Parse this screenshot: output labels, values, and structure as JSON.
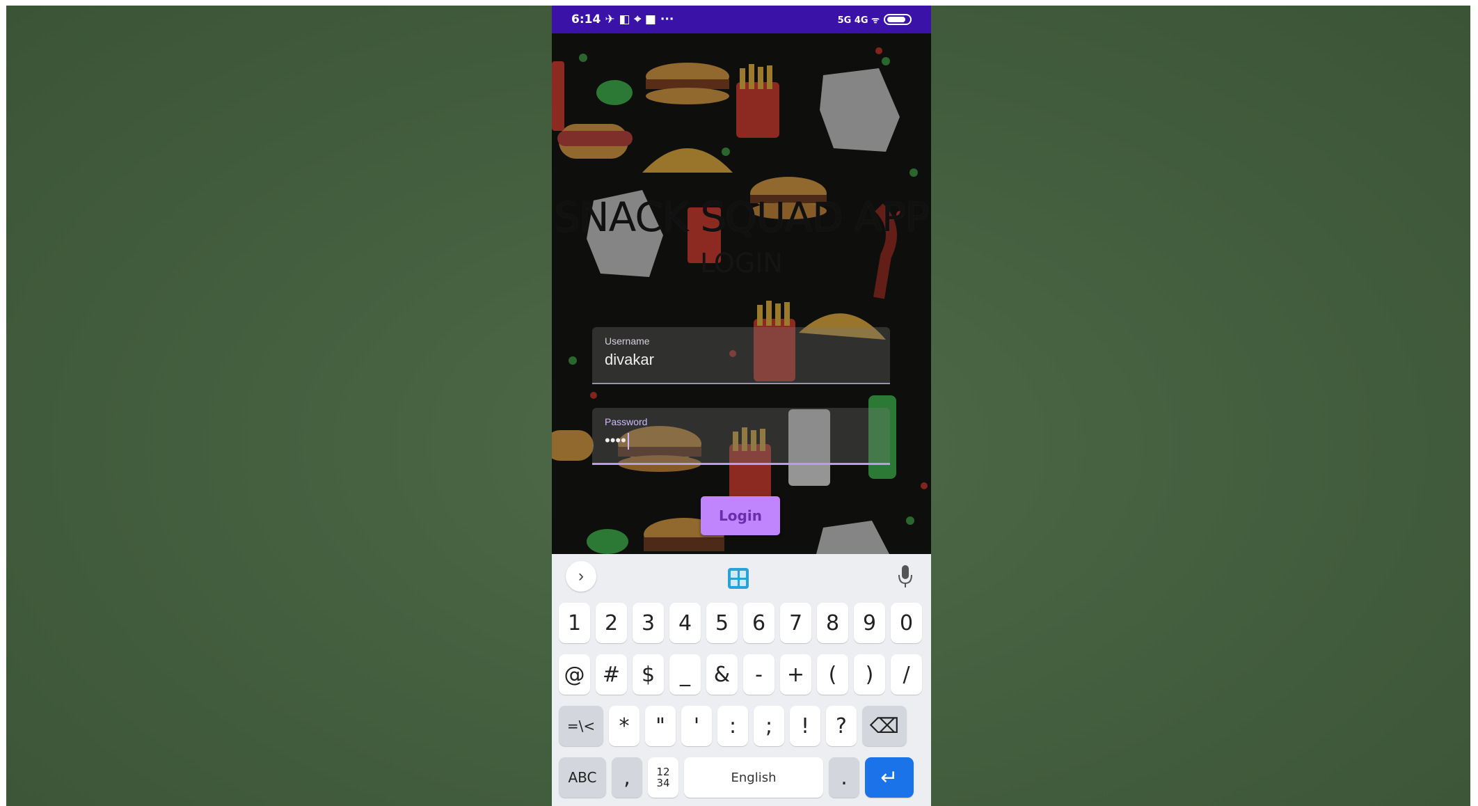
{
  "status_bar": {
    "time": "6:14",
    "left_icons": "✈ ◧ ⌖ ■ ···",
    "right_text": "5G 4G ᯤ",
    "battery": "80"
  },
  "app": {
    "title": "SNACK SQUAD APP",
    "heading": "LOGIN",
    "username": {
      "label": "Username",
      "value": "divakar"
    },
    "password": {
      "label": "Password",
      "value": "••••"
    },
    "login_button": "Login"
  },
  "keyboard": {
    "chevron": "›",
    "row1": [
      "1",
      "2",
      "3",
      "4",
      "5",
      "6",
      "7",
      "8",
      "9",
      "0"
    ],
    "row2": [
      "@",
      "#",
      "$",
      "_",
      "&",
      "-",
      "+",
      "(",
      ")",
      "/"
    ],
    "row3": [
      "*",
      "\"",
      "'",
      ":",
      ";",
      "!",
      "?"
    ],
    "row3_left": "=\\<",
    "row3_right": "⌫",
    "row4_abc": "ABC",
    "row4_comma": ",",
    "row4_num": "12\n34",
    "row4_space": "English",
    "row4_period": ".",
    "row4_enter": "↵"
  }
}
